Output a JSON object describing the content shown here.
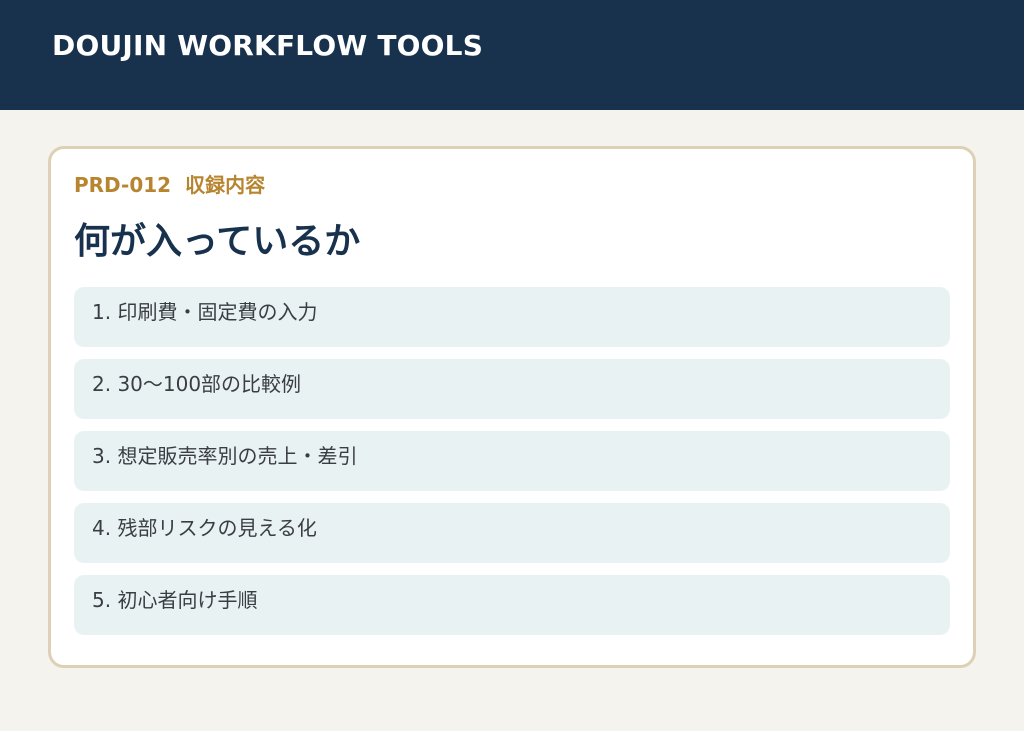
{
  "header": {
    "title": "DOUJIN WORKFLOW TOOLS"
  },
  "card": {
    "code": "PRD-012",
    "section_label": "収録内容",
    "heading": "何が入っているか",
    "items": [
      {
        "label": "1. 印刷費・固定費の入力"
      },
      {
        "label": "2. 30〜100部の比較例"
      },
      {
        "label": "3. 想定販売率別の売上・差引"
      },
      {
        "label": "4. 残部リスクの見える化"
      },
      {
        "label": "5. 初心者向け手順"
      }
    ]
  },
  "colors": {
    "header_bg": "#18324e",
    "accent": "#b7852f",
    "heading": "#18324e",
    "item_bg": "#e9f2f2",
    "card_border": "#ddd0b6",
    "page_bg": "#f5f3ee"
  }
}
